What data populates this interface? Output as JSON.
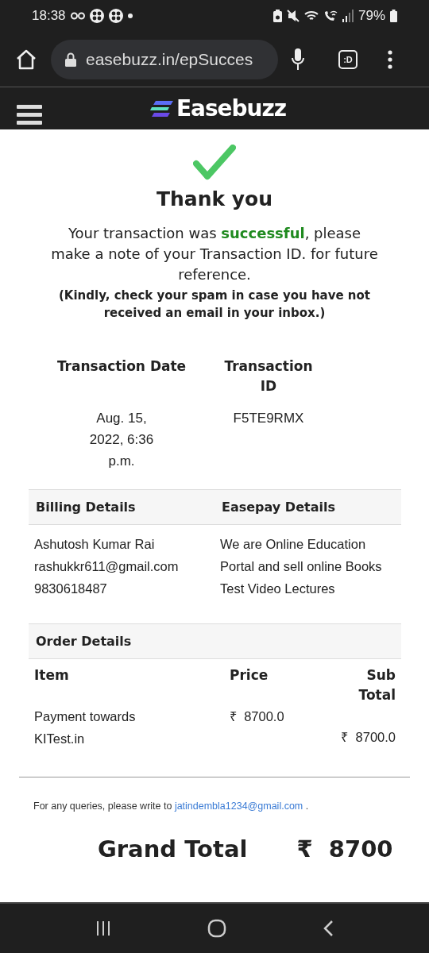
{
  "status_bar": {
    "time": "18:38",
    "battery": "79%"
  },
  "browser": {
    "url": "easebuzz.in/epSucces",
    "tab_count": ":D"
  },
  "header": {
    "logo": "Easebuzz"
  },
  "success": {
    "title": "Thank you",
    "message": "Your transaction was **successful**, please make a note of your Transaction ID. for future reference.",
    "note": "(Kindly, check your spam in case you have not received an email in your inbox.)"
  },
  "transaction": {
    "date_label": "Transaction Date",
    "date": "Aug. 15, 2022, 6:36 p.m.",
    "id_label": "Transaction ID",
    "id": "F5TE9RMX"
  },
  "details": {
    "columns": [
      "Billing Details",
      "Easepay Details"
    ],
    "billing_lines": [
      "Ashutosh Kumar Rai",
      "rashukkr611@gmail.com",
      "9830618487"
    ],
    "easepay_text": "We are Online Education Portal and sell online Books Test Video Lectures"
  },
  "order": {
    "title": "Order Details",
    "columns": [
      "Item",
      "Price",
      "Sub Total"
    ],
    "rows": [
      {
        "item": "Payment towards KITest.in",
        "price": "₹  8700.0",
        "subtotal": "₹  8700.0"
      }
    ]
  },
  "contact": {
    "text": "For any queries, please write to",
    "email": "jatindembla1234@gmail.com",
    "suffix": "."
  },
  "grand_total": {
    "label": "Grand Total",
    "amount": "₹  8700"
  }
}
